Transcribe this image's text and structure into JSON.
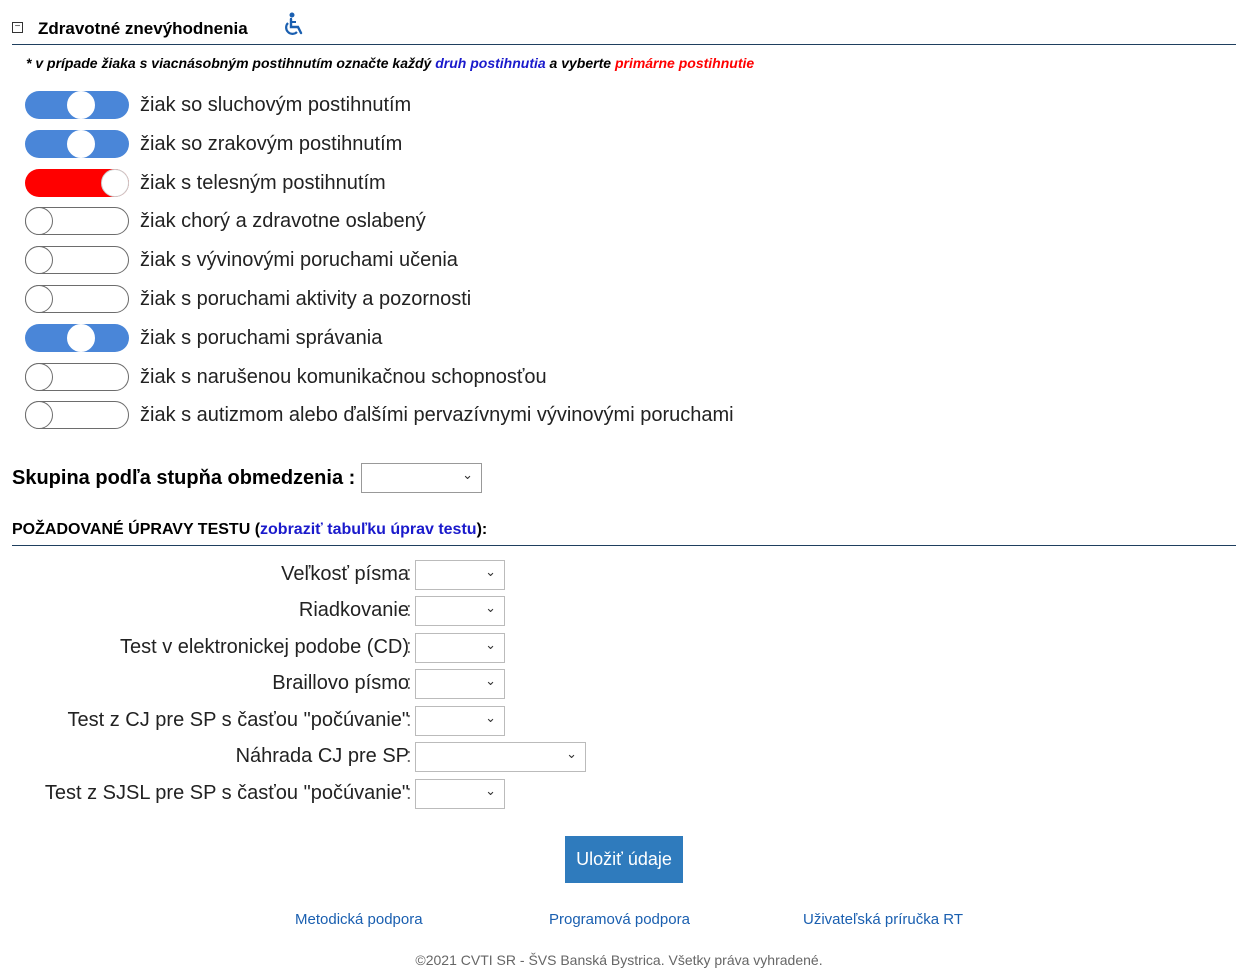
{
  "section": {
    "toggle_symbol": "−",
    "title": "Zdravotné znevýhodnenia",
    "icon": "wheelchair-icon"
  },
  "note": {
    "prefix": "* v prípade žiaka s viacnásobným postihnutím označte každý ",
    "blue_text": "druh postihnutia",
    "middle": " a vyberte ",
    "red_text": "primárne postihnutie"
  },
  "disabilities": [
    {
      "label": "žiak so sluchovým postihnutím",
      "state": "on"
    },
    {
      "label": "žiak so zrakovým postihnutím",
      "state": "on"
    },
    {
      "label": "žiak s telesným postihnutím",
      "state": "primary"
    },
    {
      "label": "žiak chorý a zdravotne oslabený",
      "state": "off"
    },
    {
      "label": "žiak s vývinovými poruchami učenia",
      "state": "off"
    },
    {
      "label": "žiak s poruchami aktivity a pozornosti",
      "state": "off"
    },
    {
      "label": "žiak s poruchami správania",
      "state": "on"
    },
    {
      "label": "žiak s narušenou komunikačnou schopnosťou",
      "state": "off"
    },
    {
      "label": "žiak s autizmom alebo ďalšími pervazívnymi vývinovými poruchami",
      "state": "off"
    }
  ],
  "group": {
    "label": "Skupina podľa stupňa obmedzenia :",
    "value": ""
  },
  "adjustments": {
    "title_prefix": "POŽADOVANÉ ÚPRAVY TESTU (",
    "link": "zobraziť tabuľku úprav testu",
    "title_suffix": "):",
    "colon": ":",
    "fields": [
      {
        "label": "Veľkosť písma",
        "value": ""
      },
      {
        "label": "Riadkovanie",
        "value": ""
      },
      {
        "label": "Test v elektronickej podobe (CD)",
        "value": ""
      },
      {
        "label": "Braillovo písmo",
        "value": ""
      },
      {
        "label": "Test z CJ pre SP s časťou \"počúvanie\"",
        "value": ""
      },
      {
        "label": "Náhrada CJ pre SP",
        "value": ""
      },
      {
        "label": "Test z SJSL pre SP s časťou \"počúvanie\"",
        "value": ""
      }
    ]
  },
  "chevron": "⌄",
  "save_label": "Uložiť údaje",
  "footer": {
    "links": [
      "Metodická podpora",
      "Programová podpora",
      "Uživateľská príručka RT"
    ],
    "copyright": "©2021 CVTI SR - ŠVS Banská Bystrica. Všetky práva vyhradené."
  },
  "colors": {
    "toggle_on": "#4a86d8",
    "toggle_primary": "#ff0000",
    "accent_blue": "#1a1acc",
    "button": "#2f7bbd"
  }
}
